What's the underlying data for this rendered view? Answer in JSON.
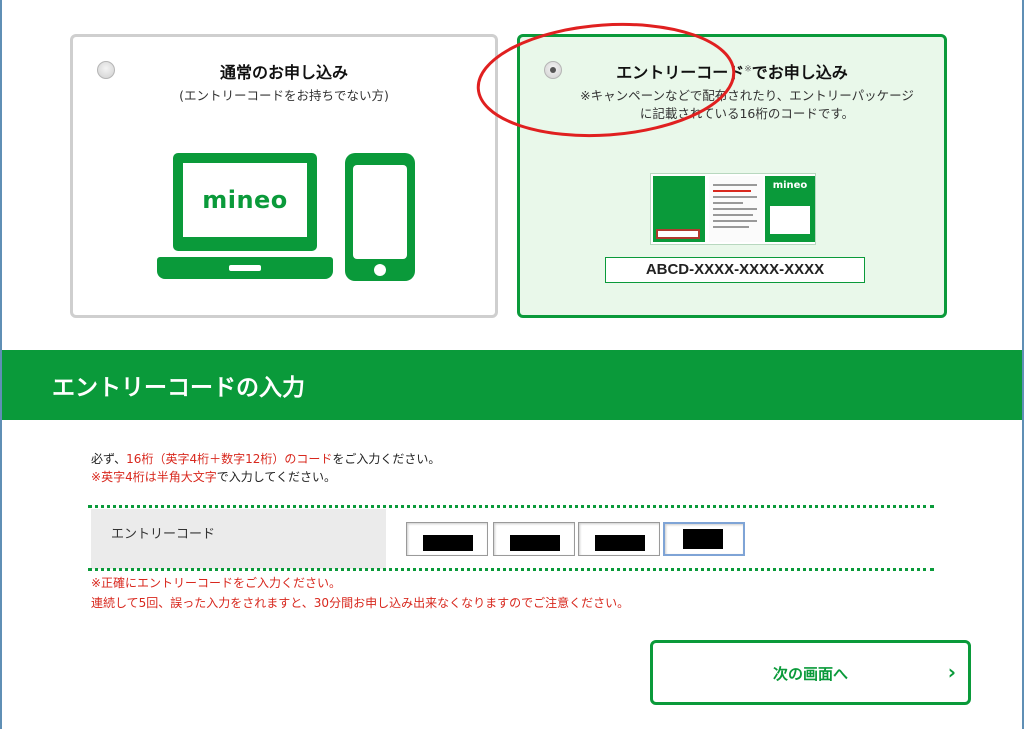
{
  "option_normal": {
    "title": "通常のお申し込み",
    "subtitle": "(エントリーコードをお持ちでない方)",
    "logo": "mineo",
    "selected": false
  },
  "option_entry": {
    "title": "エントリーコード",
    "title_mark": "※",
    "title_suffix": "でお申し込み",
    "note_line1": "※キャンペーンなどで配布されたり、エントリーパッケージ",
    "note_line2": "に記載されている16桁のコードです。",
    "package_logo": "mineo",
    "code_example": "ABCD-XXXX-XXXX-XXXX",
    "selected": true
  },
  "section": {
    "title": "エントリーコードの入力"
  },
  "instructions": {
    "l1_a": "必ず、",
    "l1_b": "16桁（英字4桁＋数字12桁）のコード",
    "l1_c": "をご入力ください。",
    "l2_a": "※",
    "l2_b": "英字4桁は半角大文字",
    "l2_c": "で入力してください。"
  },
  "field": {
    "label": "エントリーコード",
    "segments": 4,
    "active_segment": 4
  },
  "warnings": {
    "line1": "※正確にエントリーコードをご入力ください。",
    "line2": "連続して5回、誤った入力をされますと、30分間お申し込み出来なくなりますのでご注意ください。"
  },
  "next_button": {
    "label": "次の画面へ",
    "arrow": "›"
  },
  "colors": {
    "brand_green": "#0a9a3a",
    "warning_red": "#d8281e",
    "annotation_red": "#e02020"
  }
}
